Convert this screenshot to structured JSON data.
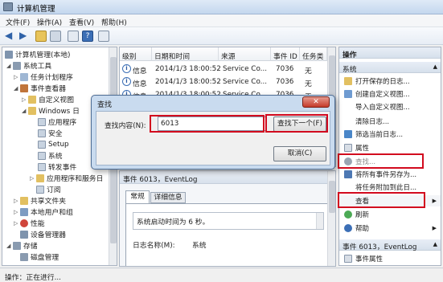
{
  "window": {
    "title": "计算机管理"
  },
  "menu": [
    "文件(F)",
    "操作(A)",
    "查看(V)",
    "帮助(H)"
  ],
  "tree": {
    "root": "计算机管理(本地)",
    "system_tools": "系统工具",
    "task_scheduler": "任务计划程序",
    "event_viewer": "事件查看器",
    "custom_views": "自定义视图",
    "windows_logs": "Windows 日",
    "application": "应用程序",
    "security": "安全",
    "setup": "Setup",
    "system": "系统",
    "forwarded": "转发事件",
    "apps_services": "应用程序和服务日",
    "subscriptions": "订阅",
    "shared_folders": "共享文件夹",
    "local_users": "本地用户和组",
    "performance": "性能",
    "device_manager": "设备管理器",
    "storage": "存储",
    "disk_management": "磁盘管理"
  },
  "event_list": {
    "columns": [
      "级别",
      "日期和时间",
      "来源",
      "事件 ID",
      "任务类"
    ],
    "rows": [
      {
        "level": "信息",
        "datetime": "2014/1/3 18:00:52",
        "source": "Service Co...",
        "id": "7036",
        "task": "无"
      },
      {
        "level": "信息",
        "datetime": "2014/1/3 18:00:52",
        "source": "Service Co...",
        "id": "7036",
        "task": "无"
      },
      {
        "level": "信息",
        "datetime": "2014/1/3 18:00:52",
        "source": "Service Co...",
        "id": "7036",
        "task": "无"
      }
    ]
  },
  "details": {
    "title": "事件 6013，EventLog",
    "tabs": [
      "常规",
      "详细信息"
    ],
    "message": "系统启动时间为 6 秒。",
    "log_name_label": "日志名称(M):",
    "log_name_value": "系统"
  },
  "actions": {
    "header": "操作",
    "section_system": "系统",
    "items": [
      "打开保存的日志...",
      "创建自定义视图...",
      "导入自定义视图...",
      "清除日志...",
      "筛选当前日志...",
      "属性",
      "查找...",
      "将所有事件另存为...",
      "将任务附加到此日...",
      "查看",
      "刷新",
      "帮助"
    ],
    "section_event": "事件 6013，EventLog",
    "event_items": [
      "事件属性"
    ]
  },
  "dialog": {
    "title": "查找",
    "label": "查找内容(N):",
    "value": "6013",
    "find_next": "查找下一个(F)",
    "cancel": "取消(C)"
  },
  "status": {
    "text": "操作：正在进行..."
  }
}
